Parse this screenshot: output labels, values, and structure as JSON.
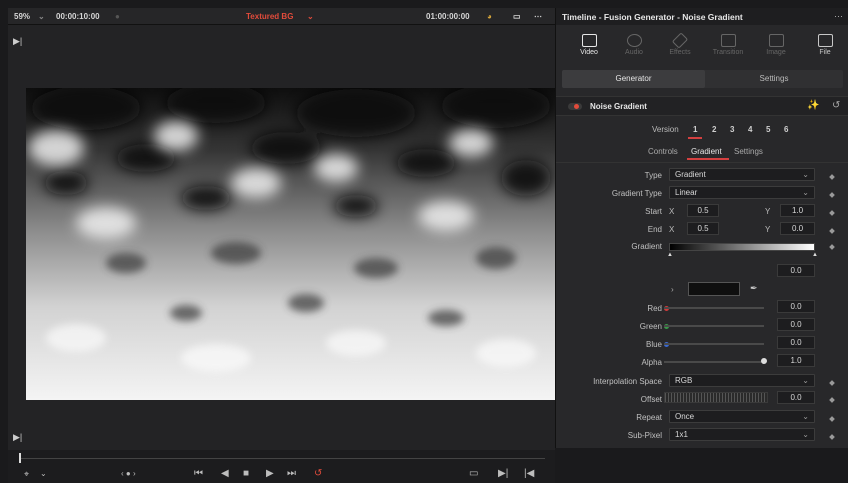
{
  "viewer": {
    "zoom": "59%",
    "timecode_left": "00:00:10:00",
    "clip_name": "Textured BG",
    "timecode_right": "01:00:00:00"
  },
  "inspector": {
    "title": "Timeline - Fusion Generator - Noise Gradient",
    "categories": [
      "Video",
      "Audio",
      "Effects",
      "Transition",
      "Image",
      "File"
    ],
    "subtabs": [
      "Generator",
      "Settings"
    ],
    "node_name": "Noise Gradient",
    "version_label": "Version",
    "versions": [
      "1",
      "2",
      "3",
      "4",
      "5",
      "6"
    ],
    "tabs": [
      "Controls",
      "Gradient",
      "Settings"
    ],
    "params": {
      "type": {
        "label": "Type",
        "value": "Gradient"
      },
      "gradient_type": {
        "label": "Gradient Type",
        "value": "Linear"
      },
      "start": {
        "label": "Start",
        "x": "0.5",
        "y": "1.0"
      },
      "end": {
        "label": "End",
        "x": "0.5",
        "y": "0.0"
      },
      "x_label": "X",
      "y_label": "Y",
      "gradient": {
        "label": "Gradient",
        "position": "0.0"
      },
      "red": {
        "label": "Red",
        "value": "0.0"
      },
      "green": {
        "label": "Green",
        "value": "0.0"
      },
      "blue": {
        "label": "Blue",
        "value": "0.0"
      },
      "alpha": {
        "label": "Alpha",
        "value": "1.0"
      },
      "interp": {
        "label": "Interpolation Space",
        "value": "RGB"
      },
      "offset": {
        "label": "Offset",
        "value": "0.0"
      },
      "repeat": {
        "label": "Repeat",
        "value": "Once"
      },
      "subpixel": {
        "label": "Sub-Pixel",
        "value": "1x1"
      }
    }
  },
  "colors": {
    "accent_red": "#e24b3b",
    "red_dot": "#d43b3b",
    "green_dot": "#3a9a4a",
    "blue_dot": "#3a6ad4"
  }
}
